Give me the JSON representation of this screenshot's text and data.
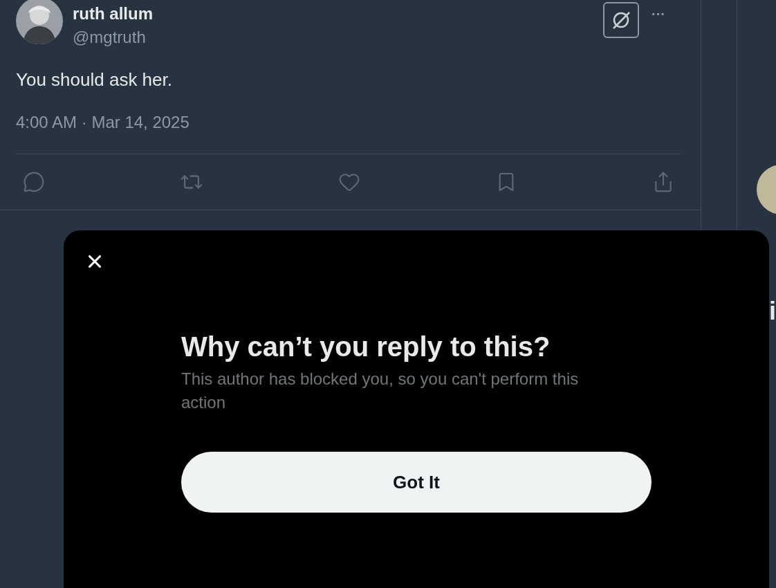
{
  "tweet": {
    "name": "ruth allum",
    "handle": "@mgtruth",
    "text": "You should ask her.",
    "timestamp": "4:00 AM · Mar 14, 2025",
    "more": "···"
  },
  "right_column": [
    "i"
  ],
  "dialog": {
    "title": "Why can’t you reply to this?",
    "message": "This author has blocked you, so you can't perform this action",
    "button": "Got It"
  }
}
